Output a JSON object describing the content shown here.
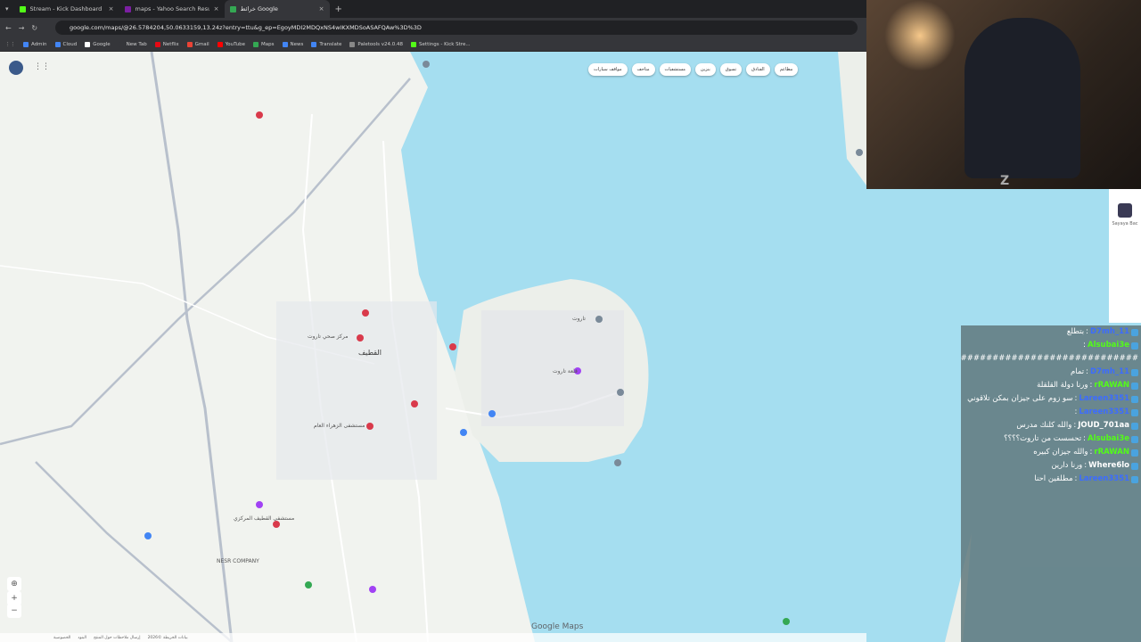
{
  "browser": {
    "tabs": [
      {
        "title": "Stream - Kick Dashboard",
        "fav_color": "#53fc18",
        "active": false
      },
      {
        "title": "maps - Yahoo Search Results",
        "fav_color": "#7b1fa2",
        "active": false
      },
      {
        "title": "خرائط Google",
        "fav_color": "#34a853",
        "active": true
      }
    ],
    "url": "google.com/maps/@26.5784204,50.0633159,13.24z?entry=ttu&g_ep=EgoyMDI2MDQxNS4wIKXMDSoASAFQAw%3D%3D",
    "bookmarks": [
      {
        "label": "Admin",
        "color": "#4285f4"
      },
      {
        "label": "Cloud",
        "color": "#4285f4"
      },
      {
        "label": "Google",
        "color": "#ffffff"
      },
      {
        "label": "New Tab",
        "color": "#35363a"
      },
      {
        "label": "Netflix",
        "color": "#e50914"
      },
      {
        "label": "Gmail",
        "color": "#ea4335"
      },
      {
        "label": "YouTube",
        "color": "#ff0000"
      },
      {
        "label": "Maps",
        "color": "#34a853"
      },
      {
        "label": "News",
        "color": "#4285f4"
      },
      {
        "label": "Translate",
        "color": "#4285f4"
      },
      {
        "label": "Paletools v24.0.48",
        "color": "#888888"
      },
      {
        "label": "Settings - Kick Stre...",
        "color": "#53fc18"
      }
    ]
  },
  "map": {
    "chips": [
      "مطاعم",
      "الفنادق",
      "تسوق",
      "بنزين",
      "مستشفيات",
      "متاحف",
      "مواقف سيارات"
    ],
    "labels": [
      {
        "text": "القطيف",
        "cls": "bigcity"
      },
      {
        "text": "مستشفى القطيف المركزي"
      },
      {
        "text": "مستشفى الزهراء العام"
      },
      {
        "text": "مركز صحي تاروت"
      },
      {
        "text": "قلعة تاروت"
      },
      {
        "text": "تاروت"
      },
      {
        "text": "NESR COMPANY"
      },
      {
        "text": "Google Maps"
      }
    ],
    "footer": [
      "الخصوصية",
      "البنود",
      "إرسال ملاحظات حول المنتج",
      "بيانات الخريطة ©2026"
    ]
  },
  "sidebar": {
    "name": "Sayaya Bac"
  },
  "chat": [
    {
      "user": "D7mh_11",
      "text": "بتطلع",
      "color": "#3c6cff"
    },
    {
      "user": "Alsubai3e",
      "text": "",
      "color": "#53fc18"
    },
    {
      "user": "",
      "text": "#############################",
      "color": "#ffffff"
    },
    {
      "user": "D7mh_11",
      "text": "تمام",
      "color": "#3c6cff"
    },
    {
      "user": "rRAWAN",
      "text": "ورنا دولة القلقلة",
      "color": "#53fc18"
    },
    {
      "user": "Lareen3351",
      "text": "سو زوم على جيزان بمكن تلاقوني",
      "color": "#3c6cff"
    },
    {
      "user": "Lareen3351",
      "text": "",
      "color": "#3c6cff"
    },
    {
      "user": "JOUD_701aa",
      "text": "والله كلنك مدرس",
      "color": "#ffffff"
    },
    {
      "user": "Alsubai3e",
      "text": "تحسست من تاروت؟؟؟؟",
      "color": "#53fc18"
    },
    {
      "user": "rRAWAN",
      "text": "والله جيزان كبيره",
      "color": "#53fc18"
    },
    {
      "user": "Where6lo",
      "text": "ورنا دارين",
      "color": "#ffffff"
    },
    {
      "user": "Lareen3351",
      "text": "مطلقين احنا",
      "color": "#3c6cff"
    }
  ]
}
